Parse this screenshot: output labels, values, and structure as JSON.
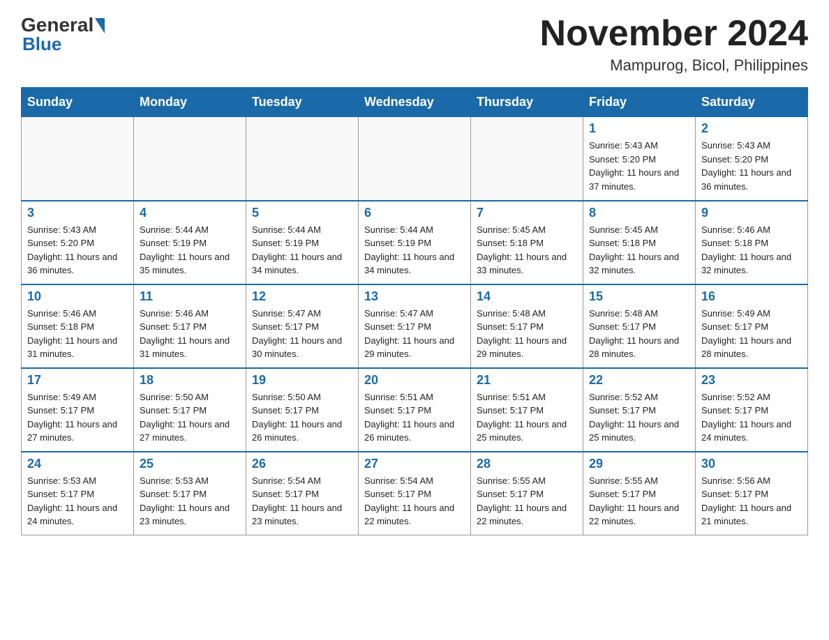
{
  "logo": {
    "name_part1": "General",
    "name_part2": "Blue"
  },
  "header": {
    "month": "November 2024",
    "location": "Mampurog, Bicol, Philippines"
  },
  "days_of_week": [
    "Sunday",
    "Monday",
    "Tuesday",
    "Wednesday",
    "Thursday",
    "Friday",
    "Saturday"
  ],
  "weeks": [
    [
      {
        "day": "",
        "sunrise": "",
        "sunset": "",
        "daylight": ""
      },
      {
        "day": "",
        "sunrise": "",
        "sunset": "",
        "daylight": ""
      },
      {
        "day": "",
        "sunrise": "",
        "sunset": "",
        "daylight": ""
      },
      {
        "day": "",
        "sunrise": "",
        "sunset": "",
        "daylight": ""
      },
      {
        "day": "",
        "sunrise": "",
        "sunset": "",
        "daylight": ""
      },
      {
        "day": "1",
        "sunrise": "Sunrise: 5:43 AM",
        "sunset": "Sunset: 5:20 PM",
        "daylight": "Daylight: 11 hours and 37 minutes."
      },
      {
        "day": "2",
        "sunrise": "Sunrise: 5:43 AM",
        "sunset": "Sunset: 5:20 PM",
        "daylight": "Daylight: 11 hours and 36 minutes."
      }
    ],
    [
      {
        "day": "3",
        "sunrise": "Sunrise: 5:43 AM",
        "sunset": "Sunset: 5:20 PM",
        "daylight": "Daylight: 11 hours and 36 minutes."
      },
      {
        "day": "4",
        "sunrise": "Sunrise: 5:44 AM",
        "sunset": "Sunset: 5:19 PM",
        "daylight": "Daylight: 11 hours and 35 minutes."
      },
      {
        "day": "5",
        "sunrise": "Sunrise: 5:44 AM",
        "sunset": "Sunset: 5:19 PM",
        "daylight": "Daylight: 11 hours and 34 minutes."
      },
      {
        "day": "6",
        "sunrise": "Sunrise: 5:44 AM",
        "sunset": "Sunset: 5:19 PM",
        "daylight": "Daylight: 11 hours and 34 minutes."
      },
      {
        "day": "7",
        "sunrise": "Sunrise: 5:45 AM",
        "sunset": "Sunset: 5:18 PM",
        "daylight": "Daylight: 11 hours and 33 minutes."
      },
      {
        "day": "8",
        "sunrise": "Sunrise: 5:45 AM",
        "sunset": "Sunset: 5:18 PM",
        "daylight": "Daylight: 11 hours and 32 minutes."
      },
      {
        "day": "9",
        "sunrise": "Sunrise: 5:46 AM",
        "sunset": "Sunset: 5:18 PM",
        "daylight": "Daylight: 11 hours and 32 minutes."
      }
    ],
    [
      {
        "day": "10",
        "sunrise": "Sunrise: 5:46 AM",
        "sunset": "Sunset: 5:18 PM",
        "daylight": "Daylight: 11 hours and 31 minutes."
      },
      {
        "day": "11",
        "sunrise": "Sunrise: 5:46 AM",
        "sunset": "Sunset: 5:17 PM",
        "daylight": "Daylight: 11 hours and 31 minutes."
      },
      {
        "day": "12",
        "sunrise": "Sunrise: 5:47 AM",
        "sunset": "Sunset: 5:17 PM",
        "daylight": "Daylight: 11 hours and 30 minutes."
      },
      {
        "day": "13",
        "sunrise": "Sunrise: 5:47 AM",
        "sunset": "Sunset: 5:17 PM",
        "daylight": "Daylight: 11 hours and 29 minutes."
      },
      {
        "day": "14",
        "sunrise": "Sunrise: 5:48 AM",
        "sunset": "Sunset: 5:17 PM",
        "daylight": "Daylight: 11 hours and 29 minutes."
      },
      {
        "day": "15",
        "sunrise": "Sunrise: 5:48 AM",
        "sunset": "Sunset: 5:17 PM",
        "daylight": "Daylight: 11 hours and 28 minutes."
      },
      {
        "day": "16",
        "sunrise": "Sunrise: 5:49 AM",
        "sunset": "Sunset: 5:17 PM",
        "daylight": "Daylight: 11 hours and 28 minutes."
      }
    ],
    [
      {
        "day": "17",
        "sunrise": "Sunrise: 5:49 AM",
        "sunset": "Sunset: 5:17 PM",
        "daylight": "Daylight: 11 hours and 27 minutes."
      },
      {
        "day": "18",
        "sunrise": "Sunrise: 5:50 AM",
        "sunset": "Sunset: 5:17 PM",
        "daylight": "Daylight: 11 hours and 27 minutes."
      },
      {
        "day": "19",
        "sunrise": "Sunrise: 5:50 AM",
        "sunset": "Sunset: 5:17 PM",
        "daylight": "Daylight: 11 hours and 26 minutes."
      },
      {
        "day": "20",
        "sunrise": "Sunrise: 5:51 AM",
        "sunset": "Sunset: 5:17 PM",
        "daylight": "Daylight: 11 hours and 26 minutes."
      },
      {
        "day": "21",
        "sunrise": "Sunrise: 5:51 AM",
        "sunset": "Sunset: 5:17 PM",
        "daylight": "Daylight: 11 hours and 25 minutes."
      },
      {
        "day": "22",
        "sunrise": "Sunrise: 5:52 AM",
        "sunset": "Sunset: 5:17 PM",
        "daylight": "Daylight: 11 hours and 25 minutes."
      },
      {
        "day": "23",
        "sunrise": "Sunrise: 5:52 AM",
        "sunset": "Sunset: 5:17 PM",
        "daylight": "Daylight: 11 hours and 24 minutes."
      }
    ],
    [
      {
        "day": "24",
        "sunrise": "Sunrise: 5:53 AM",
        "sunset": "Sunset: 5:17 PM",
        "daylight": "Daylight: 11 hours and 24 minutes."
      },
      {
        "day": "25",
        "sunrise": "Sunrise: 5:53 AM",
        "sunset": "Sunset: 5:17 PM",
        "daylight": "Daylight: 11 hours and 23 minutes."
      },
      {
        "day": "26",
        "sunrise": "Sunrise: 5:54 AM",
        "sunset": "Sunset: 5:17 PM",
        "daylight": "Daylight: 11 hours and 23 minutes."
      },
      {
        "day": "27",
        "sunrise": "Sunrise: 5:54 AM",
        "sunset": "Sunset: 5:17 PM",
        "daylight": "Daylight: 11 hours and 22 minutes."
      },
      {
        "day": "28",
        "sunrise": "Sunrise: 5:55 AM",
        "sunset": "Sunset: 5:17 PM",
        "daylight": "Daylight: 11 hours and 22 minutes."
      },
      {
        "day": "29",
        "sunrise": "Sunrise: 5:55 AM",
        "sunset": "Sunset: 5:17 PM",
        "daylight": "Daylight: 11 hours and 22 minutes."
      },
      {
        "day": "30",
        "sunrise": "Sunrise: 5:56 AM",
        "sunset": "Sunset: 5:17 PM",
        "daylight": "Daylight: 11 hours and 21 minutes."
      }
    ]
  ]
}
